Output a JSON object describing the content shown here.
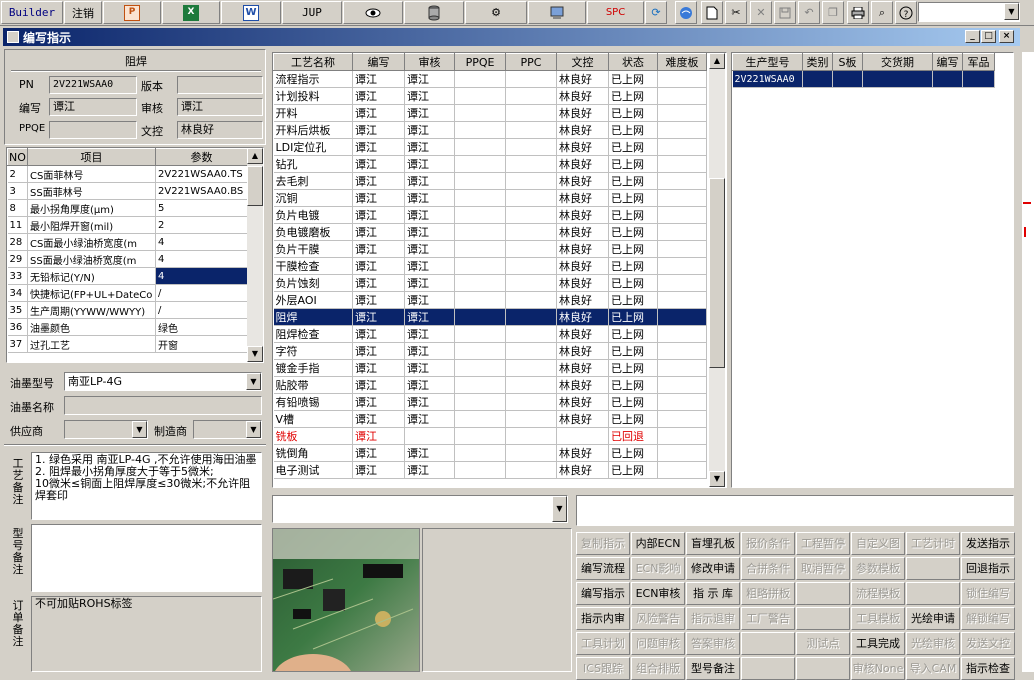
{
  "toolbar": {
    "builder": "Builder",
    "logout": "注销",
    "jup": "JUP",
    "spc": "SPC",
    "combo_value": ""
  },
  "window": {
    "title": "编写指示"
  },
  "header": {
    "section_title": "阻焊",
    "pn_label": "PN",
    "pn_value": "2V221WSAA0",
    "version_label": "版本",
    "version_value": "",
    "writer_label": "编写",
    "writer_value": "谭江",
    "reviewer_label": "审核",
    "reviewer_value": "谭江",
    "ppqe_label": "PPQE",
    "ppqe_value": "",
    "doc_label": "文控",
    "doc_value": "林良好"
  },
  "params": {
    "headers": [
      "NO",
      "项目",
      "参数"
    ],
    "rows": [
      {
        "no": "2",
        "item": "CS面菲林号",
        "value": "2V221WSAA0.TS"
      },
      {
        "no": "3",
        "item": "SS面菲林号",
        "value": "2V221WSAA0.BS"
      },
      {
        "no": "8",
        "item": "最小拐角厚度(μm)",
        "value": "5"
      },
      {
        "no": "11",
        "item": "最小阻焊开窗(mil)",
        "value": "2"
      },
      {
        "no": "28",
        "item": "CS面最小绿油桥宽度(m",
        "value": "4"
      },
      {
        "no": "29",
        "item": "SS面最小绿油桥宽度(m",
        "value": "4"
      },
      {
        "no": "33",
        "item": "无铅标记(Y/N)",
        "value": "4"
      },
      {
        "no": "34",
        "item": "快捷标记(FP+UL+DateCo",
        "value": "/"
      },
      {
        "no": "35",
        "item": "生产周期(YYWW/WWYY)",
        "value": "/"
      },
      {
        "no": "36",
        "item": "油墨颜色",
        "value": "绿色"
      },
      {
        "no": "37",
        "item": "过孔工艺",
        "value": "开窗"
      }
    ]
  },
  "ink": {
    "type_label": "油墨型号",
    "type_value": "南亚LP-4G",
    "name_label": "油墨名称",
    "name_value": "",
    "supplier_label": "供应商",
    "supplier_value": "",
    "maker_label": "制造商",
    "maker_value": ""
  },
  "notes": {
    "process_label": "工艺备注",
    "process_text": "1. 绿色采用 南亚LP-4G ,不允许使用海田油墨\n2. 阻焊最小拐角厚度大于等于5微米;\n10微米≤铜面上阻焊厚度≤30微米;不允许阻焊套印",
    "type_label": "型号备注",
    "type_text": "",
    "order_label": "订单备注",
    "order_text": "不可加贴ROHS标签"
  },
  "process": {
    "headers": [
      "工艺名称",
      "编写",
      "审核",
      "PPQE",
      "PPC",
      "文控",
      "状态",
      "难度板"
    ],
    "rows": [
      {
        "name": "流程指示",
        "writer": "谭江",
        "reviewer": "谭江",
        "ppqe": "",
        "ppc": "",
        "doc": "林良好",
        "status": "已上网",
        "hard": ""
      },
      {
        "name": "计划投料",
        "writer": "谭江",
        "reviewer": "谭江",
        "ppqe": "",
        "ppc": "",
        "doc": "林良好",
        "status": "已上网",
        "hard": ""
      },
      {
        "name": "开料",
        "writer": "谭江",
        "reviewer": "谭江",
        "ppqe": "",
        "ppc": "",
        "doc": "林良好",
        "status": "已上网",
        "hard": ""
      },
      {
        "name": "开料后烘板",
        "writer": "谭江",
        "reviewer": "谭江",
        "ppqe": "",
        "ppc": "",
        "doc": "林良好",
        "status": "已上网",
        "hard": ""
      },
      {
        "name": "LDI定位孔",
        "writer": "谭江",
        "reviewer": "谭江",
        "ppqe": "",
        "ppc": "",
        "doc": "林良好",
        "status": "已上网",
        "hard": ""
      },
      {
        "name": "钻孔",
        "writer": "谭江",
        "reviewer": "谭江",
        "ppqe": "",
        "ppc": "",
        "doc": "林良好",
        "status": "已上网",
        "hard": ""
      },
      {
        "name": "去毛刺",
        "writer": "谭江",
        "reviewer": "谭江",
        "ppqe": "",
        "ppc": "",
        "doc": "林良好",
        "status": "已上网",
        "hard": ""
      },
      {
        "name": "沉铜",
        "writer": "谭江",
        "reviewer": "谭江",
        "ppqe": "",
        "ppc": "",
        "doc": "林良好",
        "status": "已上网",
        "hard": ""
      },
      {
        "name": "负片电镀",
        "writer": "谭江",
        "reviewer": "谭江",
        "ppqe": "",
        "ppc": "",
        "doc": "林良好",
        "status": "已上网",
        "hard": ""
      },
      {
        "name": "负电镀磨板",
        "writer": "谭江",
        "reviewer": "谭江",
        "ppqe": "",
        "ppc": "",
        "doc": "林良好",
        "status": "已上网",
        "hard": ""
      },
      {
        "name": "负片干膜",
        "writer": "谭江",
        "reviewer": "谭江",
        "ppqe": "",
        "ppc": "",
        "doc": "林良好",
        "status": "已上网",
        "hard": ""
      },
      {
        "name": "干膜检查",
        "writer": "谭江",
        "reviewer": "谭江",
        "ppqe": "",
        "ppc": "",
        "doc": "林良好",
        "status": "已上网",
        "hard": ""
      },
      {
        "name": "负片蚀刻",
        "writer": "谭江",
        "reviewer": "谭江",
        "ppqe": "",
        "ppc": "",
        "doc": "林良好",
        "status": "已上网",
        "hard": ""
      },
      {
        "name": "外层AOI",
        "writer": "谭江",
        "reviewer": "谭江",
        "ppqe": "",
        "ppc": "",
        "doc": "林良好",
        "status": "已上网",
        "hard": ""
      },
      {
        "name": "阻焊",
        "writer": "谭江",
        "reviewer": "谭江",
        "ppqe": "",
        "ppc": "",
        "doc": "林良好",
        "status": "已上网",
        "hard": "",
        "sel": true
      },
      {
        "name": "阻焊检查",
        "writer": "谭江",
        "reviewer": "谭江",
        "ppqe": "",
        "ppc": "",
        "doc": "林良好",
        "status": "已上网",
        "hard": ""
      },
      {
        "name": "字符",
        "writer": "谭江",
        "reviewer": "谭江",
        "ppqe": "",
        "ppc": "",
        "doc": "林良好",
        "status": "已上网",
        "hard": ""
      },
      {
        "name": "镀金手指",
        "writer": "谭江",
        "reviewer": "谭江",
        "ppqe": "",
        "ppc": "",
        "doc": "林良好",
        "status": "已上网",
        "hard": ""
      },
      {
        "name": "贴胶带",
        "writer": "谭江",
        "reviewer": "谭江",
        "ppqe": "",
        "ppc": "",
        "doc": "林良好",
        "status": "已上网",
        "hard": ""
      },
      {
        "name": "有铅喷锡",
        "writer": "谭江",
        "reviewer": "谭江",
        "ppqe": "",
        "ppc": "",
        "doc": "林良好",
        "status": "已上网",
        "hard": ""
      },
      {
        "name": "V槽",
        "writer": "谭江",
        "reviewer": "谭江",
        "ppqe": "",
        "ppc": "",
        "doc": "林良好",
        "status": "已上网",
        "hard": ""
      },
      {
        "name": "铣板",
        "writer": "谭江",
        "reviewer": "",
        "ppqe": "",
        "ppc": "",
        "doc": "",
        "status": "已回退",
        "hard": "",
        "red": true
      },
      {
        "name": "铣倒角",
        "writer": "谭江",
        "reviewer": "谭江",
        "ppqe": "",
        "ppc": "",
        "doc": "林良好",
        "status": "已上网",
        "hard": ""
      },
      {
        "name": "电子测试",
        "writer": "谭江",
        "reviewer": "谭江",
        "ppqe": "",
        "ppc": "",
        "doc": "林良好",
        "status": "已上网",
        "hard": ""
      }
    ]
  },
  "orders": {
    "headers": [
      "生产型号",
      "类别",
      "S板",
      "交货期",
      "编写",
      "军品"
    ],
    "rows": [
      {
        "model": "2V221WSAA0",
        "type": "",
        "s": "",
        "date": "",
        "writer": "",
        "mil": ""
      }
    ]
  },
  "actions": [
    {
      "label": "复制指示",
      "enabled": false
    },
    {
      "label": "内部ECN",
      "enabled": true
    },
    {
      "label": "盲埋孔板",
      "enabled": true
    },
    {
      "label": "报价条件",
      "enabled": false
    },
    {
      "label": "工程暂停",
      "enabled": false
    },
    {
      "label": "自定义图",
      "enabled": false
    },
    {
      "label": "工艺计时",
      "enabled": false
    },
    {
      "label": "发送指示",
      "enabled": true
    },
    {
      "label": "编写流程",
      "enabled": true
    },
    {
      "label": "ECN影响",
      "enabled": false
    },
    {
      "label": "修改申请",
      "enabled": true
    },
    {
      "label": "合拼条件",
      "enabled": false
    },
    {
      "label": "取消暂停",
      "enabled": false
    },
    {
      "label": "参数模板",
      "enabled": false
    },
    {
      "label": "",
      "enabled": false
    },
    {
      "label": "回退指示",
      "enabled": true
    },
    {
      "label": "编写指示",
      "enabled": true
    },
    {
      "label": "ECN审核",
      "enabled": true
    },
    {
      "label": "指 示 库",
      "enabled": true
    },
    {
      "label": "粗略拼板",
      "enabled": false
    },
    {
      "label": "",
      "enabled": false
    },
    {
      "label": "流程模板",
      "enabled": false
    },
    {
      "label": "",
      "enabled": false
    },
    {
      "label": "锁住编写",
      "enabled": false
    },
    {
      "label": "指示内审",
      "enabled": true
    },
    {
      "label": "风险警告",
      "enabled": false
    },
    {
      "label": "指示退审",
      "enabled": false
    },
    {
      "label": "工厂警告",
      "enabled": false
    },
    {
      "label": "",
      "enabled": false
    },
    {
      "label": "工具模板",
      "enabled": false
    },
    {
      "label": "光绘申请",
      "enabled": true
    },
    {
      "label": "解锁编写",
      "enabled": false
    },
    {
      "label": "工具计划",
      "enabled": false
    },
    {
      "label": "问题审核",
      "enabled": false
    },
    {
      "label": "答案审核",
      "enabled": false
    },
    {
      "label": "",
      "enabled": false
    },
    {
      "label": "测试点",
      "enabled": false
    },
    {
      "label": "工具完成",
      "enabled": true
    },
    {
      "label": "光绘审核",
      "enabled": false
    },
    {
      "label": "发送文控",
      "enabled": false
    },
    {
      "label": "ICS跟踪",
      "enabled": false
    },
    {
      "label": "组合排版",
      "enabled": false
    },
    {
      "label": "型号备注",
      "enabled": true
    },
    {
      "label": "",
      "enabled": false
    },
    {
      "label": "",
      "enabled": false
    },
    {
      "label": "审核None",
      "enabled": false
    },
    {
      "label": "导入CAM",
      "enabled": false
    },
    {
      "label": "指示检查",
      "enabled": true
    }
  ],
  "bottom_combo_value": "",
  "colors": {
    "selection": "#0a246a",
    "title_start": "#0a246a",
    "title_end": "#a6caf0",
    "rollback_red": "#e00000"
  }
}
